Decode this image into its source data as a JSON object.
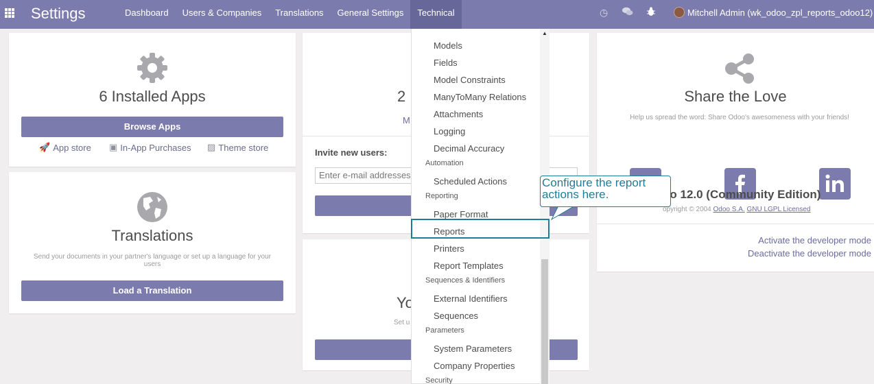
{
  "navbar": {
    "brand": "Settings",
    "menu": [
      "Dashboard",
      "Users & Companies",
      "Translations",
      "General Settings",
      "Technical"
    ],
    "user": "Mitchell Admin (wk_odoo_zpl_reports_odoo12)",
    "colors": {
      "navbar": "#7c7bad",
      "active": "#68679a"
    }
  },
  "apps_card": {
    "title": "6 Installed Apps",
    "button": "Browse Apps",
    "links": [
      "App store",
      "In-App Purchases",
      "Theme store"
    ]
  },
  "users_card": {
    "count_partial": "2",
    "link_partial": "M",
    "invite_label": "Invite new users:",
    "invite_placeholder": "Enter e-mail addresses"
  },
  "bottom_mid_card": {
    "title_partial": "Yo",
    "sub_partial": "Set u"
  },
  "translations_card": {
    "title": "Translations",
    "subtitle": "Send your documents in your partner's language or set up a language for your users",
    "button": "Load a Translation"
  },
  "share_card": {
    "title": "Share the Love",
    "subtitle": "Help us spread the word: Share Odoo's awesomeness with your friends!",
    "social": [
      "twitter-icon",
      "facebook-icon",
      "linkedin-icon"
    ],
    "edition": "oo 12.0 (Community Edition)",
    "copyright_prefix": "opyright © 2004",
    "company_link": "Odoo S.A.",
    "license_link": "GNU LGPL Licensed",
    "activate": "Activate the developer mode",
    "deactivate": "Deactivate the developer mode"
  },
  "dropdown": {
    "items": [
      {
        "type": "item",
        "label": "Models"
      },
      {
        "type": "item",
        "label": "Fields"
      },
      {
        "type": "item",
        "label": "Model Constraints"
      },
      {
        "type": "item",
        "label": "ManyToMany Relations"
      },
      {
        "type": "item",
        "label": "Attachments"
      },
      {
        "type": "item",
        "label": "Logging"
      },
      {
        "type": "item",
        "label": "Decimal Accuracy"
      },
      {
        "type": "header",
        "label": "Automation"
      },
      {
        "type": "item",
        "label": "Scheduled Actions"
      },
      {
        "type": "header",
        "label": "Reporting"
      },
      {
        "type": "item",
        "label": "Paper Format"
      },
      {
        "type": "item",
        "label": "Reports"
      },
      {
        "type": "item",
        "label": "Printers"
      },
      {
        "type": "item",
        "label": "Report Templates"
      },
      {
        "type": "header",
        "label": "Sequences & Identifiers"
      },
      {
        "type": "item",
        "label": "External Identifiers"
      },
      {
        "type": "item",
        "label": "Sequences"
      },
      {
        "type": "header",
        "label": "Parameters"
      },
      {
        "type": "item",
        "label": "System Parameters"
      },
      {
        "type": "item",
        "label": "Company Properties"
      },
      {
        "type": "header",
        "label": "Security"
      }
    ]
  },
  "callout": {
    "text": "Configure the report actions here.",
    "color": "#1f7c96"
  }
}
